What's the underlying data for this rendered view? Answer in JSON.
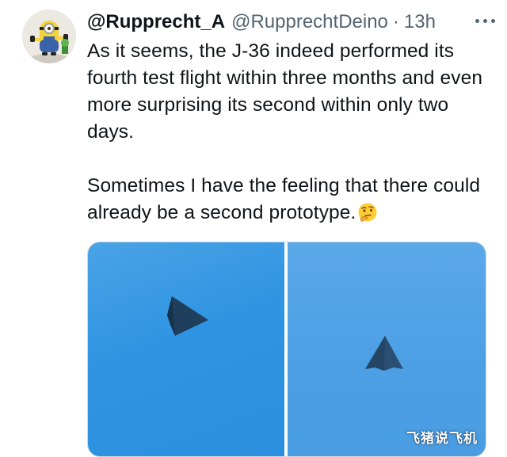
{
  "tweet": {
    "author": {
      "display_name": "@Rupprecht_A",
      "handle": "@RupprechtDeino",
      "separator": "·",
      "timestamp": "13h"
    },
    "text": {
      "paragraph_1": "As it seems, the J-36 indeed performed its fourth test flight within three months and even more surprising its second within only two days.",
      "paragraph_2": "Sometimes I have the feeling that there could already be a second prototype."
    },
    "emoji": "thinking-face",
    "media": {
      "count": 2,
      "photos": [
        {
          "subject": "aircraft-silhouette"
        },
        {
          "subject": "aircraft-silhouette"
        }
      ],
      "watermark": "飞猪说飞机"
    }
  },
  "icons": {
    "more": "more-horizontal-icon",
    "avatar": "minion-avatar"
  },
  "colors": {
    "text": "#0f1419",
    "secondary": "#536471",
    "sky_left": "#2f94e2",
    "sky_right": "#4c9fe4",
    "jet": "#1f3f5c"
  }
}
